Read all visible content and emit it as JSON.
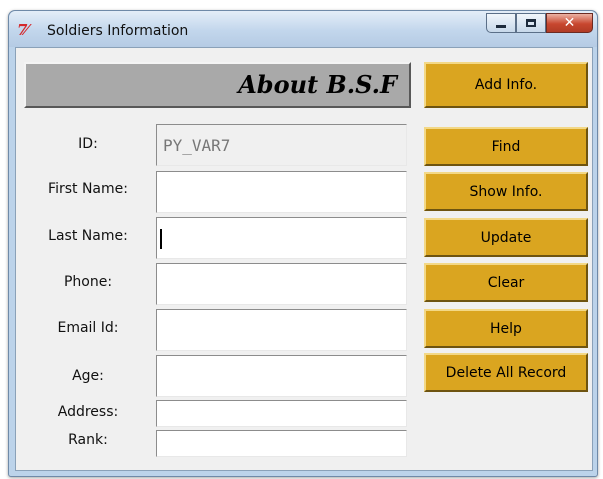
{
  "window": {
    "title": "Soldiers Information",
    "icon": "tk-feather-icon",
    "controls": [
      "minimize-icon",
      "maximize-icon",
      "close-icon"
    ]
  },
  "header": {
    "title": "About B.S.F"
  },
  "form": {
    "fields": [
      {
        "label": "ID:",
        "value": "PY_VAR7"
      },
      {
        "label": "First Name:",
        "value": ""
      },
      {
        "label": "Last Name:",
        "value": ""
      },
      {
        "label": "Phone:",
        "value": ""
      },
      {
        "label": "Email Id:",
        "value": ""
      },
      {
        "label": "Age:",
        "value": ""
      },
      {
        "label": "Address:",
        "value": ""
      },
      {
        "label": "Rank:",
        "value": ""
      }
    ]
  },
  "buttons": [
    "Add Info.",
    "Find",
    "Show Info.",
    "Update",
    "Clear",
    "Help",
    "Delete All Record"
  ],
  "colors": {
    "button": "#daa520",
    "header_bg": "#a9a9a9",
    "client_bg": "#f0f0f0"
  }
}
